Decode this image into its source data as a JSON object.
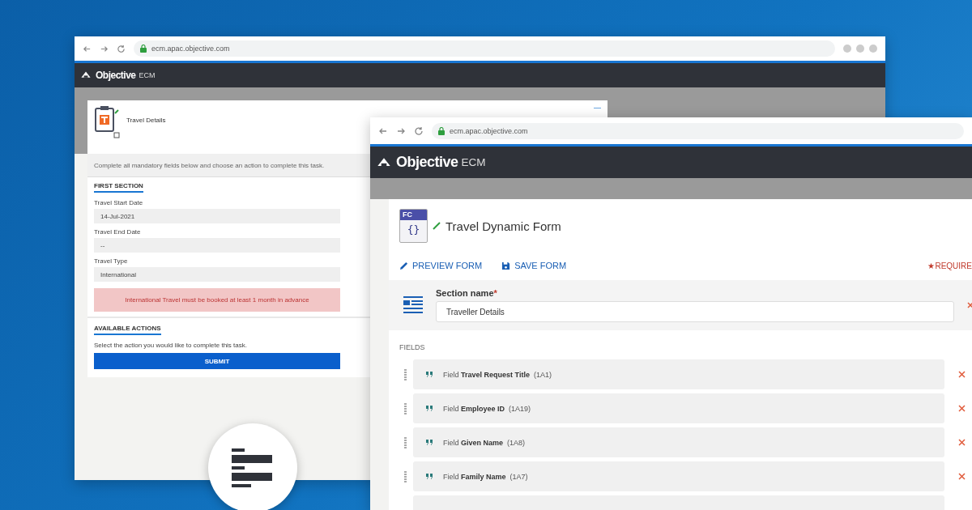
{
  "back_window": {
    "url": "ecm.apac.objective.com",
    "brand": "Objective",
    "product": "ECM",
    "task": {
      "title": "Travel Details",
      "minimize": "—",
      "instructions": "Complete all mandatory fields below and choose an action to complete this task.",
      "section_title": "FIRST SECTION",
      "fields": [
        {
          "label": "Travel Start Date",
          "value": "14-Jul-2021"
        },
        {
          "label": "Travel End Date",
          "value": "--"
        },
        {
          "label": "Travel Type",
          "value": "International"
        }
      ],
      "alert": "International Travel must be booked at least 1 month in advance",
      "actions_title": "AVAILABLE ACTIONS",
      "actions_hint": "Select the action you would like to complete this task.",
      "submit": "SUBMIT"
    }
  },
  "front_window": {
    "url": "ecm.apac.objective.com",
    "brand": "Objective",
    "product": "ECM",
    "form": {
      "icon_label": "FC",
      "icon_braces": "{}",
      "title": "Travel Dynamic Form",
      "actions": [
        {
          "kind": "preview",
          "label": "PREVIEW FORM"
        },
        {
          "kind": "save",
          "label": "SAVE FORM"
        }
      ],
      "required_mark": "★",
      "required_label": "REQUIRE",
      "section_label": "Section name",
      "section_required": "*",
      "section_value": "Traveller Details",
      "fields_heading": "FIELDS",
      "fields": [
        {
          "prefix": "Field",
          "name": "Travel Request Title",
          "code": "(1A1)"
        },
        {
          "prefix": "Field",
          "name": "Employee ID",
          "code": "(1A19)"
        },
        {
          "prefix": "Field",
          "name": "Given Name",
          "code": "(1A8)"
        },
        {
          "prefix": "Field",
          "name": "Family Name",
          "code": "(1A7)"
        }
      ]
    }
  }
}
